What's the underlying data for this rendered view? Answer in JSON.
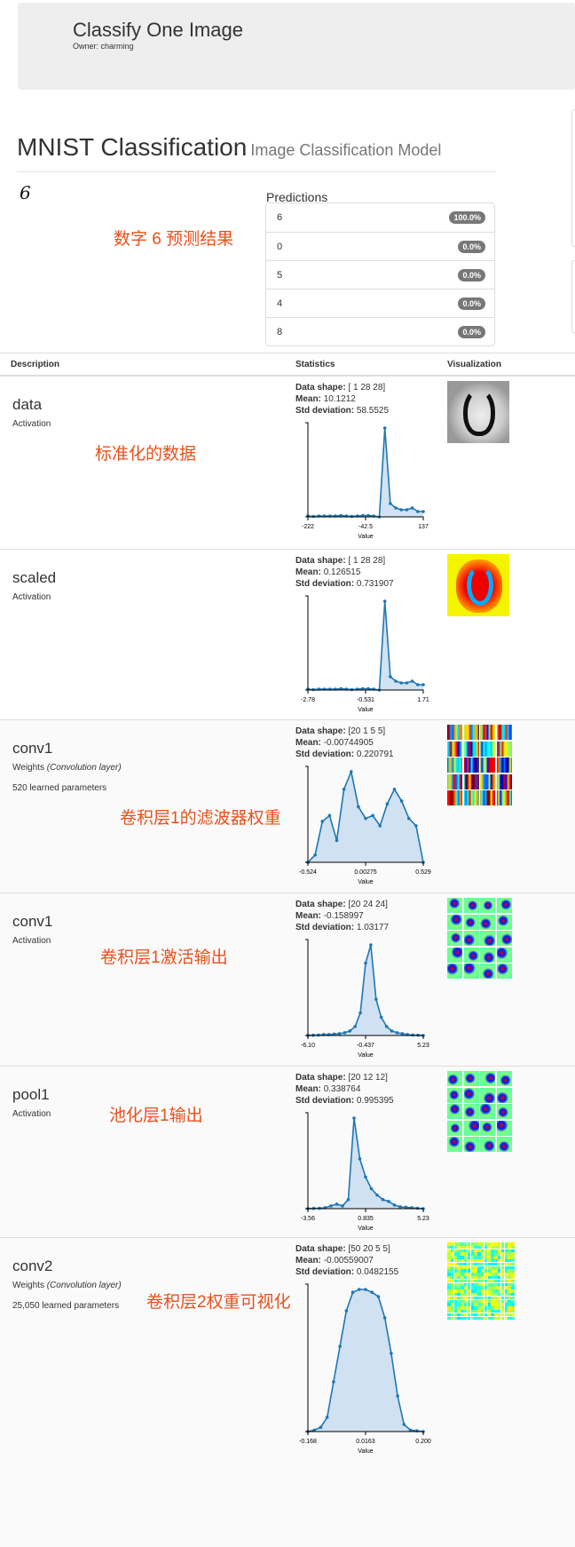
{
  "header": {
    "title": "Classify One Image",
    "owner": "Owner: charming"
  },
  "model": {
    "title": "MNIST Classification",
    "subtitle": "Image Classification Model"
  },
  "input_digit": "6",
  "annotation_predictions": "数字 6 预测结果",
  "predictions": {
    "heading": "Predictions",
    "items": [
      {
        "label": "6",
        "value": "100.0%"
      },
      {
        "label": "0",
        "value": "0.0%"
      },
      {
        "label": "5",
        "value": "0.0%"
      },
      {
        "label": "4",
        "value": "0.0%"
      },
      {
        "label": "8",
        "value": "0.0%"
      }
    ]
  },
  "table": {
    "headers": [
      "Description",
      "Statistics",
      "Visualization"
    ]
  },
  "stat_labels": {
    "shape": "Data shape:",
    "mean": "Mean:",
    "std": "Std deviation:"
  },
  "layers": [
    {
      "name": "data",
      "type": "Activation",
      "type_note": "",
      "params": "",
      "annotation": "标准化的数据",
      "shape": "[ 1 28 28]",
      "mean": "10.1212",
      "std": "58.5525",
      "viz": "gray-digit",
      "hist": {
        "xticks": [
          "-222",
          "-42.5",
          "137"
        ],
        "xlabel": "Value",
        "counts": [
          1,
          0.5,
          1,
          1,
          1,
          1,
          1.5,
          1,
          0.5,
          1,
          1.5,
          1.5,
          1,
          0,
          100,
          15,
          10,
          8,
          8,
          10,
          6,
          6
        ]
      }
    },
    {
      "name": "scaled",
      "type": "Activation",
      "type_note": "",
      "params": "",
      "annotation": "",
      "shape": "[ 1 28 28]",
      "mean": "0.126515",
      "std": "0.731907",
      "viz": "heat-digit",
      "hist": {
        "xticks": [
          "-2.78",
          "-0.531",
          "1.71"
        ],
        "xlabel": "Value",
        "counts": [
          1,
          0.5,
          1,
          1,
          1,
          1,
          1.5,
          1,
          0.5,
          1,
          1.5,
          1.5,
          1,
          0,
          100,
          15,
          10,
          8,
          8,
          10,
          6,
          6
        ]
      }
    },
    {
      "name": "conv1",
      "type": "Weights",
      "type_note": "(Convolution layer)",
      "params": "520 learned parameters",
      "annotation": "卷积层1的滤波器权重",
      "shape": "[20 1 5 5]",
      "mean": "-0.00744905",
      "std": "0.220791",
      "viz": "grid-4x5",
      "hist": {
        "xticks": [
          "-0.524",
          "0.00275",
          "0.529"
        ],
        "xlabel": "Value",
        "counts": [
          0,
          5,
          28,
          32,
          15,
          50,
          62,
          38,
          30,
          32,
          25,
          40,
          50,
          42,
          30,
          25,
          0
        ]
      }
    },
    {
      "name": "conv1",
      "type": "Activation",
      "type_note": "",
      "params": "",
      "annotation": "卷积层1激活输出",
      "shape": "[20 24 24]",
      "mean": "-0.158997",
      "std": "1.03177",
      "viz": "grid-4x5-green",
      "hist": {
        "xticks": [
          "-6.10",
          "-0.437",
          "5.23"
        ],
        "xlabel": "Value",
        "counts": [
          0,
          0.3,
          0.5,
          1,
          1,
          1.5,
          2,
          3,
          5,
          10,
          25,
          80,
          100,
          40,
          20,
          10,
          5,
          3,
          2,
          1,
          0.5,
          0.3,
          0
        ]
      }
    },
    {
      "name": "pool1",
      "type": "Activation",
      "type_note": "",
      "params": "",
      "annotation": "池化层1输出",
      "shape": "[20 12 12]",
      "mean": "0.338764",
      "std": "0.995395",
      "viz": "grid-4x5-green",
      "hist": {
        "xticks": [
          "-3.56",
          "0.835",
          "5.23"
        ],
        "xlabel": "Value",
        "counts": [
          0,
          0.3,
          0.5,
          1,
          3,
          5,
          3,
          10,
          100,
          55,
          35,
          22,
          15,
          10,
          8,
          4,
          2,
          1.5,
          1,
          0.5,
          0
        ]
      }
    },
    {
      "name": "conv2",
      "type": "Weights",
      "type_note": "(Convolution layer)",
      "params": "25,050 learned parameters",
      "annotation": "卷积层2权重可视化",
      "shape": "[50 20 5 5]",
      "mean": "-0.00559007",
      "std": "0.0482155",
      "viz": "grid-dense",
      "hist": {
        "xticks": [
          "-0.168",
          "0.0163",
          "0.200"
        ],
        "xlabel": "Value",
        "counts": [
          0,
          1,
          3,
          10,
          35,
          60,
          85,
          98,
          100,
          100,
          98,
          95,
          80,
          55,
          25,
          5,
          1,
          0.5,
          0
        ]
      }
    }
  ],
  "colors": {
    "line": "#1f77b4",
    "fill": "#c6dbef",
    "annotation": "#e8501a",
    "badge": "#777777"
  }
}
